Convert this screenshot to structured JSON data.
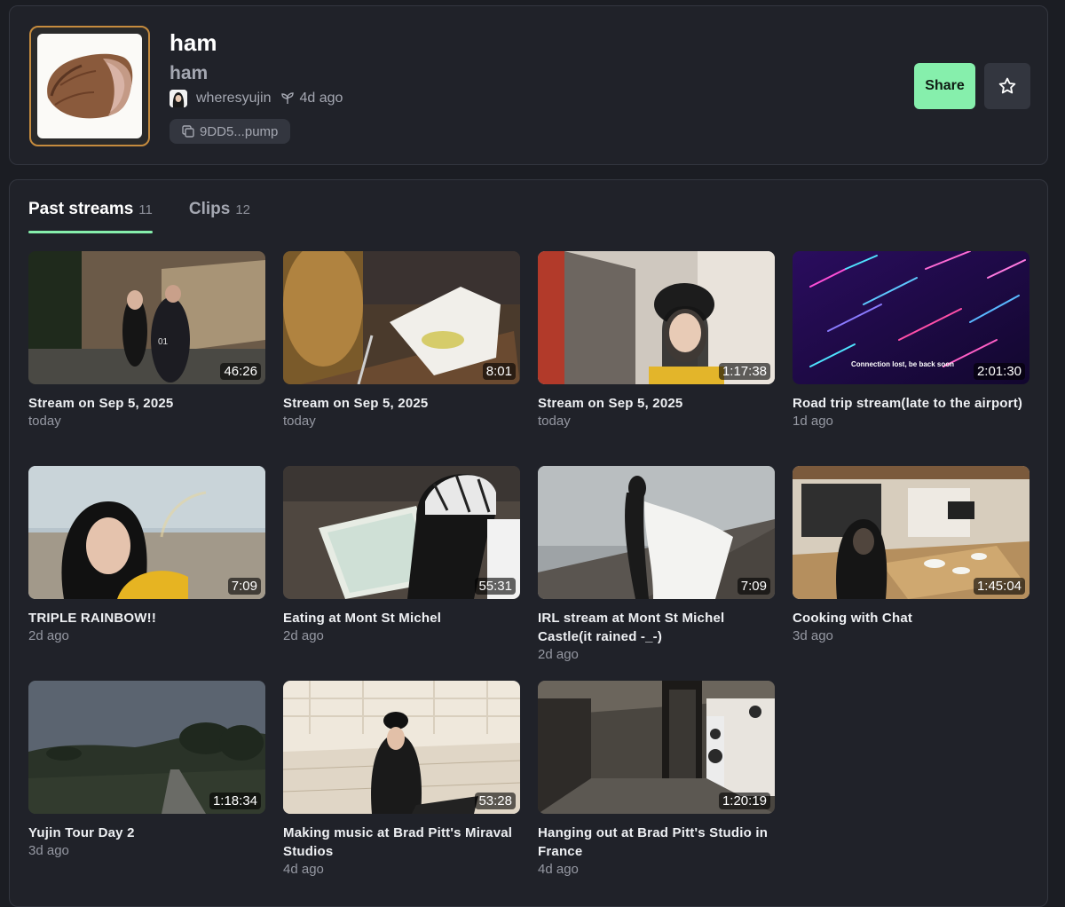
{
  "token": {
    "name": "ham",
    "ticker": "ham",
    "creator": "wheresyujin",
    "age": "4d ago",
    "address": "9DD5...pump"
  },
  "actions": {
    "share_label": "Share",
    "favorite_icon": "star-icon"
  },
  "tabs": [
    {
      "label": "Past streams",
      "count": "11",
      "active": true
    },
    {
      "label": "Clips",
      "count": "12",
      "active": false
    }
  ],
  "streams": [
    {
      "title": "Stream on Sep 5, 2025",
      "age": "today",
      "duration": "46:26"
    },
    {
      "title": "Stream on Sep 5, 2025",
      "age": "today",
      "duration": "8:01"
    },
    {
      "title": "Stream on Sep 5, 2025",
      "age": "today",
      "duration": "1:17:38"
    },
    {
      "title": "Road trip stream(late to the airport)",
      "age": "1d ago",
      "duration": "2:01:30",
      "overlay_text": "Connection lost, be back soon"
    },
    {
      "title": "TRIPLE RAINBOW!!",
      "age": "2d ago",
      "duration": "7:09"
    },
    {
      "title": "Eating at Mont St Michel",
      "age": "2d ago",
      "duration": "55:31"
    },
    {
      "title": "IRL stream at Mont St Michel Castle(it rained -_-)",
      "age": "2d ago",
      "duration": "7:09"
    },
    {
      "title": "Cooking with Chat",
      "age": "3d ago",
      "duration": "1:45:04"
    },
    {
      "title": "Yujin Tour Day 2",
      "age": "3d ago",
      "duration": "1:18:34"
    },
    {
      "title": "Making music at Brad Pitt's Miraval Studios",
      "age": "4d ago",
      "duration": "53:28"
    },
    {
      "title": "Hanging out at Brad Pitt's Studio in France",
      "age": "4d ago",
      "duration": "1:20:19"
    }
  ],
  "colors": {
    "accent": "#86efac",
    "background": "#1b1d23",
    "card": "#202229",
    "token_border": "#c58b3e"
  }
}
